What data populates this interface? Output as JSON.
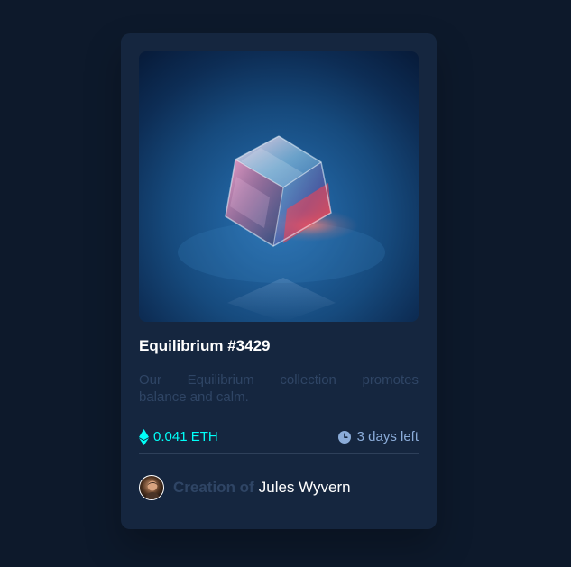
{
  "card": {
    "title": "Equilibrium #3429",
    "description_line1": "Our Equilibrium collection promotes",
    "description_line2": "balance and calm.",
    "price": "0.041 ETH",
    "time_left": "3 days left",
    "creator_prefix": "Creation of",
    "creator_name": "Jules Wyvern"
  },
  "icons": {
    "price_icon": "ethereum-icon",
    "time_icon": "clock-icon",
    "avatar_icon": "avatar-image"
  },
  "colors": {
    "background": "#0d192b",
    "card": "#15263f",
    "price": "#00fff8",
    "muted": "#8bacd9",
    "text": "#ffffff",
    "dim_text": "#2f4565",
    "divider": "#2e405a"
  }
}
